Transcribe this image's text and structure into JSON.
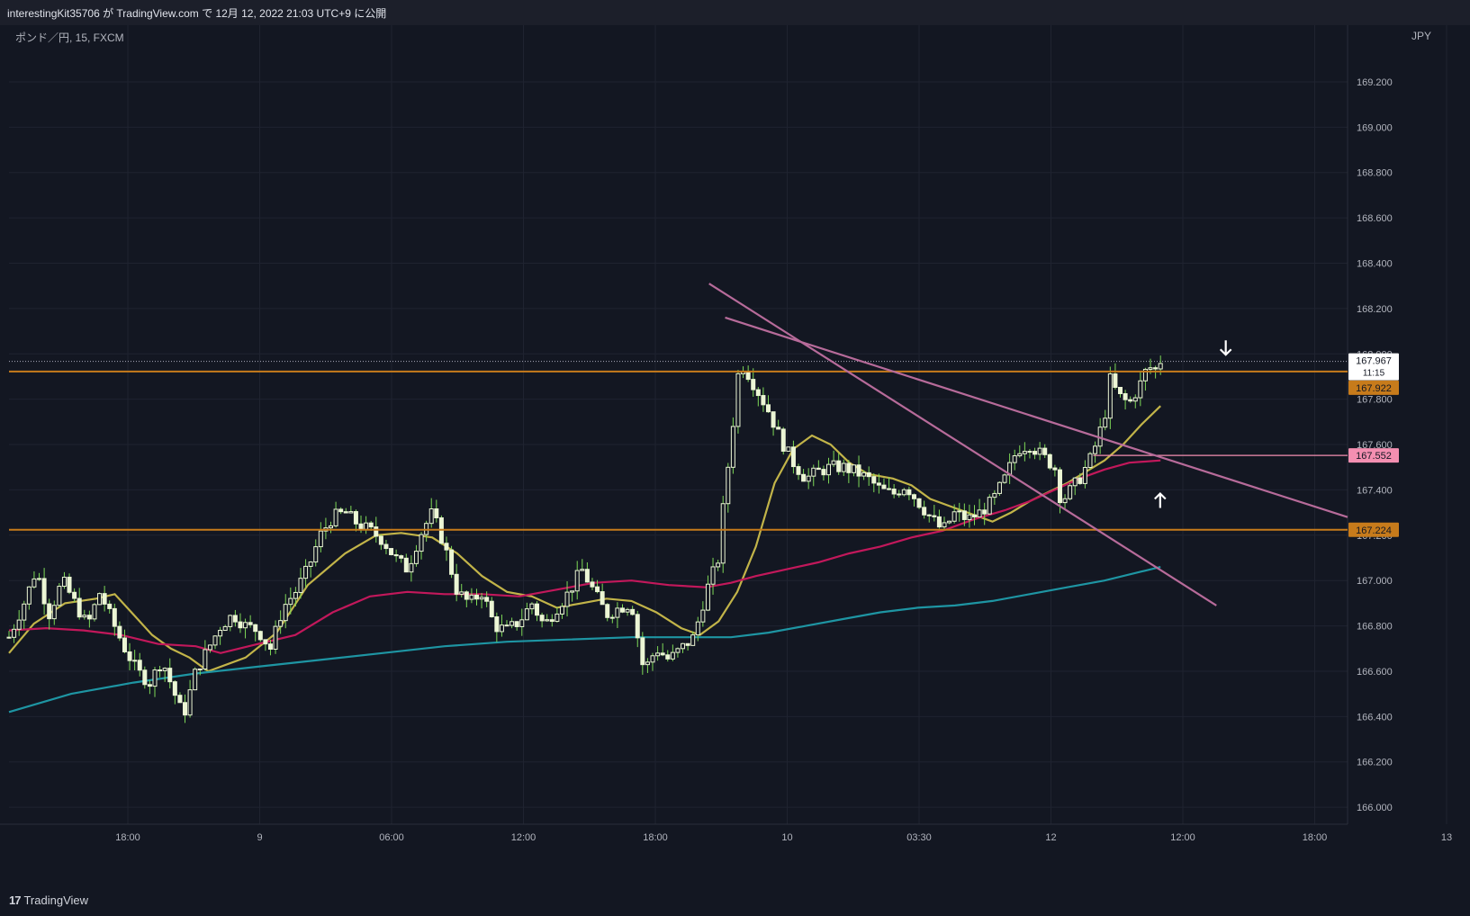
{
  "header": {
    "published_text": "interestingKit35706 が TradingView.com で 12月 12, 2022 21:03 UTC+9 に公開"
  },
  "symbol_legend": "ポンド／円, 15, FXCM",
  "currency": "JPY",
  "footer": {
    "logo_mark": "17",
    "logo_text": "TradingView"
  },
  "colors": {
    "background": "#131722",
    "grid": "#1f2330",
    "axis_text": "#b2b5be",
    "up_candle": "#ecf6d5",
    "down_candle": "#ecf6d5",
    "wick_up": "#7ed957",
    "wick_down": "#7ed957",
    "ma_short": "#c2b449",
    "ma_mid": "#c2185b",
    "ma_long": "#1e95a3",
    "level_orange": "#c77b1b",
    "level_pink": "#f48fb1",
    "trend_line": "#b76b9a",
    "arrow": "#ffffff"
  },
  "chart_data": {
    "type": "candlestick",
    "title": "",
    "symbol": "ポンド／円, 15, FXCM",
    "ylim": [
      165.925,
      169.45
    ],
    "y_ticks": [
      169.2,
      169.0,
      168.8,
      168.6,
      168.4,
      168.2,
      168.0,
      167.8,
      167.6,
      167.4,
      167.2,
      167.0,
      166.8,
      166.6,
      166.4,
      166.2,
      166.0
    ],
    "x_ticks": [
      "18:00",
      "9",
      "06:00",
      "12:00",
      "18:00",
      "10",
      "03:30",
      "12",
      "12:00",
      "18:00",
      "13"
    ],
    "price_labels": [
      {
        "value": 167.967,
        "text": "167.967",
        "sub": "11:15",
        "kind": "current"
      },
      {
        "value": 167.922,
        "text": "167.922",
        "kind": "orange"
      },
      {
        "value": 167.552,
        "text": "167.552",
        "kind": "pink"
      },
      {
        "value": 167.224,
        "text": "167.224",
        "kind": "orange"
      }
    ],
    "horizontal_levels": [
      {
        "value": 167.922,
        "kind": "orange"
      },
      {
        "value": 167.224,
        "kind": "orange"
      },
      {
        "value": 167.552,
        "kind": "pink",
        "x_start_frac": 0.81
      }
    ],
    "trend_lines": [
      {
        "from": [
          0.523,
          168.31
        ],
        "to": [
          0.902,
          166.89
        ]
      },
      {
        "from": [
          0.535,
          168.16
        ],
        "to": [
          1.0,
          167.28
        ]
      }
    ],
    "arrows": [
      {
        "x": 0.909,
        "y": 168.02,
        "dir": "down"
      },
      {
        "x": 0.86,
        "y": 167.36,
        "dir": "up"
      }
    ],
    "ma_series": [
      {
        "key": "short",
        "color_key": "ma_short",
        "points": [
          [
            0,
            166.68
          ],
          [
            0.02,
            166.81
          ],
          [
            0.045,
            166.9
          ],
          [
            0.07,
            166.92
          ],
          [
            0.085,
            166.94
          ],
          [
            0.1,
            166.85
          ],
          [
            0.115,
            166.76
          ],
          [
            0.13,
            166.7
          ],
          [
            0.145,
            166.66
          ],
          [
            0.16,
            166.6
          ],
          [
            0.19,
            166.66
          ],
          [
            0.215,
            166.77
          ],
          [
            0.24,
            166.98
          ],
          [
            0.27,
            167.12
          ],
          [
            0.295,
            167.2
          ],
          [
            0.315,
            167.21
          ],
          [
            0.34,
            167.19
          ],
          [
            0.36,
            167.12
          ],
          [
            0.38,
            167.02
          ],
          [
            0.4,
            166.95
          ],
          [
            0.42,
            166.93
          ],
          [
            0.44,
            166.88
          ],
          [
            0.46,
            166.9
          ],
          [
            0.48,
            166.92
          ],
          [
            0.5,
            166.91
          ],
          [
            0.52,
            166.86
          ],
          [
            0.54,
            166.79
          ],
          [
            0.555,
            166.76
          ],
          [
            0.57,
            166.82
          ],
          [
            0.585,
            166.95
          ],
          [
            0.6,
            167.15
          ],
          [
            0.615,
            167.43
          ],
          [
            0.63,
            167.58
          ],
          [
            0.645,
            167.64
          ],
          [
            0.66,
            167.6
          ],
          [
            0.675,
            167.52
          ],
          [
            0.69,
            167.47
          ],
          [
            0.71,
            167.45
          ],
          [
            0.725,
            167.42
          ],
          [
            0.74,
            167.36
          ],
          [
            0.76,
            167.32
          ],
          [
            0.775,
            167.29
          ],
          [
            0.79,
            167.26
          ],
          [
            0.805,
            167.3
          ],
          [
            0.82,
            167.35
          ],
          [
            0.835,
            167.39
          ],
          [
            0.85,
            167.43
          ],
          [
            0.865,
            167.48
          ],
          [
            0.88,
            167.53
          ],
          [
            0.895,
            167.6
          ],
          [
            0.91,
            167.69
          ],
          [
            0.925,
            167.77
          ]
        ]
      },
      {
        "key": "mid",
        "color_key": "ma_mid",
        "points": [
          [
            0,
            166.78
          ],
          [
            0.03,
            166.79
          ],
          [
            0.06,
            166.78
          ],
          [
            0.09,
            166.76
          ],
          [
            0.12,
            166.72
          ],
          [
            0.15,
            166.71
          ],
          [
            0.17,
            166.68
          ],
          [
            0.2,
            166.72
          ],
          [
            0.23,
            166.76
          ],
          [
            0.26,
            166.86
          ],
          [
            0.29,
            166.93
          ],
          [
            0.32,
            166.95
          ],
          [
            0.35,
            166.94
          ],
          [
            0.38,
            166.94
          ],
          [
            0.41,
            166.93
          ],
          [
            0.44,
            166.96
          ],
          [
            0.47,
            166.99
          ],
          [
            0.5,
            167.0
          ],
          [
            0.53,
            166.98
          ],
          [
            0.56,
            166.97
          ],
          [
            0.58,
            166.99
          ],
          [
            0.6,
            167.02
          ],
          [
            0.625,
            167.05
          ],
          [
            0.65,
            167.08
          ],
          [
            0.675,
            167.12
          ],
          [
            0.7,
            167.15
          ],
          [
            0.725,
            167.19
          ],
          [
            0.75,
            167.22
          ],
          [
            0.775,
            167.27
          ],
          [
            0.8,
            167.31
          ],
          [
            0.82,
            167.35
          ],
          [
            0.84,
            167.4
          ],
          [
            0.86,
            167.45
          ],
          [
            0.88,
            167.49
          ],
          [
            0.9,
            167.52
          ],
          [
            0.925,
            167.53
          ]
        ]
      },
      {
        "key": "long",
        "color_key": "ma_long",
        "points": [
          [
            0,
            166.42
          ],
          [
            0.05,
            166.5
          ],
          [
            0.1,
            166.55
          ],
          [
            0.15,
            166.59
          ],
          [
            0.2,
            166.62
          ],
          [
            0.25,
            166.65
          ],
          [
            0.3,
            166.68
          ],
          [
            0.35,
            166.71
          ],
          [
            0.4,
            166.73
          ],
          [
            0.45,
            166.74
          ],
          [
            0.5,
            166.75
          ],
          [
            0.55,
            166.75
          ],
          [
            0.58,
            166.75
          ],
          [
            0.61,
            166.77
          ],
          [
            0.64,
            166.8
          ],
          [
            0.67,
            166.83
          ],
          [
            0.7,
            166.86
          ],
          [
            0.73,
            166.88
          ],
          [
            0.76,
            166.89
          ],
          [
            0.79,
            166.91
          ],
          [
            0.82,
            166.94
          ],
          [
            0.85,
            166.97
          ],
          [
            0.88,
            167.0
          ],
          [
            0.91,
            167.04
          ],
          [
            0.925,
            167.06
          ]
        ]
      }
    ],
    "candle_anchors": [
      [
        0,
        166.75
      ],
      [
        0.012,
        166.9
      ],
      [
        0.022,
        167.05
      ],
      [
        0.032,
        166.85
      ],
      [
        0.043,
        167.0
      ],
      [
        0.053,
        166.9
      ],
      [
        0.063,
        166.8
      ],
      [
        0.073,
        166.95
      ],
      [
        0.083,
        166.82
      ],
      [
        0.093,
        166.7
      ],
      [
        0.103,
        166.6
      ],
      [
        0.113,
        166.55
      ],
      [
        0.123,
        166.65
      ],
      [
        0.133,
        166.5
      ],
      [
        0.14,
        166.4
      ],
      [
        0.15,
        166.6
      ],
      [
        0.16,
        166.7
      ],
      [
        0.17,
        166.8
      ],
      [
        0.18,
        166.85
      ],
      [
        0.19,
        166.8
      ],
      [
        0.2,
        166.78
      ],
      [
        0.21,
        166.7
      ],
      [
        0.22,
        166.88
      ],
      [
        0.23,
        166.95
      ],
      [
        0.24,
        167.05
      ],
      [
        0.25,
        167.2
      ],
      [
        0.26,
        167.28
      ],
      [
        0.27,
        167.3
      ],
      [
        0.28,
        167.25
      ],
      [
        0.29,
        167.22
      ],
      [
        0.3,
        167.18
      ],
      [
        0.31,
        167.1
      ],
      [
        0.32,
        167.05
      ],
      [
        0.33,
        167.2
      ],
      [
        0.34,
        167.3
      ],
      [
        0.35,
        167.15
      ],
      [
        0.36,
        166.95
      ],
      [
        0.37,
        166.9
      ],
      [
        0.38,
        166.95
      ],
      [
        0.39,
        166.8
      ],
      [
        0.4,
        166.78
      ],
      [
        0.41,
        166.82
      ],
      [
        0.42,
        166.9
      ],
      [
        0.43,
        166.8
      ],
      [
        0.44,
        166.88
      ],
      [
        0.45,
        166.95
      ],
      [
        0.46,
        167.05
      ],
      [
        0.47,
        166.95
      ],
      [
        0.48,
        166.85
      ],
      [
        0.49,
        166.88
      ],
      [
        0.5,
        166.9
      ],
      [
        0.505,
        166.75
      ],
      [
        0.51,
        166.6
      ],
      [
        0.52,
        166.7
      ],
      [
        0.53,
        166.65
      ],
      [
        0.54,
        166.7
      ],
      [
        0.55,
        166.75
      ],
      [
        0.56,
        166.95
      ],
      [
        0.57,
        167.1
      ],
      [
        0.575,
        167.4
      ],
      [
        0.58,
        167.6
      ],
      [
        0.585,
        167.9
      ],
      [
        0.59,
        167.95
      ],
      [
        0.6,
        167.85
      ],
      [
        0.61,
        167.75
      ],
      [
        0.62,
        167.62
      ],
      [
        0.63,
        167.52
      ],
      [
        0.64,
        167.45
      ],
      [
        0.65,
        167.48
      ],
      [
        0.66,
        167.5
      ],
      [
        0.67,
        167.5
      ],
      [
        0.68,
        167.48
      ],
      [
        0.69,
        167.45
      ],
      [
        0.7,
        167.4
      ],
      [
        0.71,
        167.38
      ],
      [
        0.72,
        167.42
      ],
      [
        0.73,
        167.35
      ],
      [
        0.74,
        167.28
      ],
      [
        0.75,
        167.22
      ],
      [
        0.76,
        167.3
      ],
      [
        0.77,
        167.27
      ],
      [
        0.78,
        167.3
      ],
      [
        0.79,
        167.35
      ],
      [
        0.8,
        167.45
      ],
      [
        0.81,
        167.58
      ],
      [
        0.82,
        167.6
      ],
      [
        0.83,
        167.55
      ],
      [
        0.84,
        167.5
      ],
      [
        0.845,
        167.35
      ],
      [
        0.85,
        167.38
      ],
      [
        0.86,
        167.45
      ],
      [
        0.87,
        167.55
      ],
      [
        0.88,
        167.72
      ],
      [
        0.885,
        167.9
      ],
      [
        0.89,
        167.82
      ],
      [
        0.9,
        167.78
      ],
      [
        0.91,
        167.88
      ],
      [
        0.915,
        167.95
      ],
      [
        0.92,
        167.92
      ],
      [
        0.925,
        167.97
      ]
    ]
  }
}
